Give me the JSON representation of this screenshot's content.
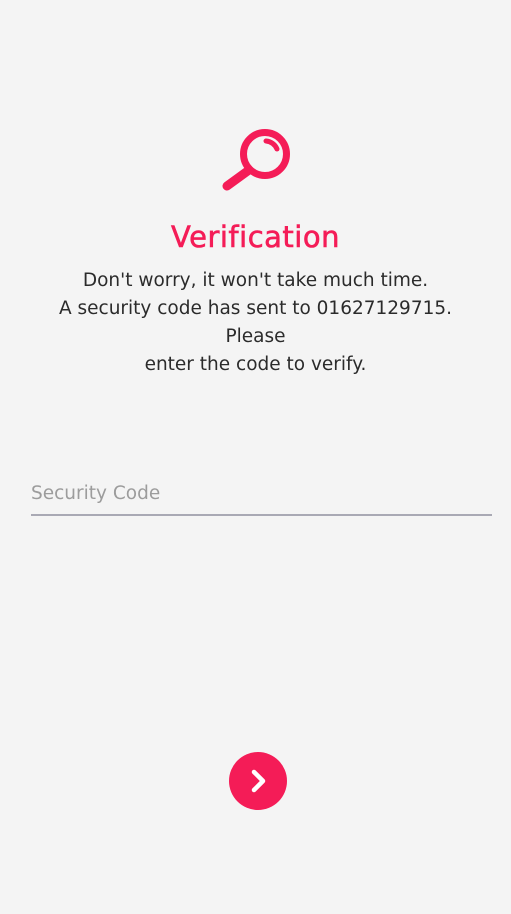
{
  "header": {
    "icon": "search-icon",
    "title": "Verification"
  },
  "message": {
    "line1": "Don't worry, it won't take much time.",
    "line2": "A security code has sent to 01627129715. Please",
    "line3": "enter the code to verify."
  },
  "form": {
    "security_code": {
      "value": "",
      "placeholder": "Security Code"
    }
  },
  "actions": {
    "next_icon": "chevron-right-icon"
  },
  "colors": {
    "accent": "#f41c57",
    "background": "#f4f4f4",
    "text": "#2b2b2b",
    "placeholder": "#9c9c9c",
    "underline": "#a9a9b4"
  }
}
